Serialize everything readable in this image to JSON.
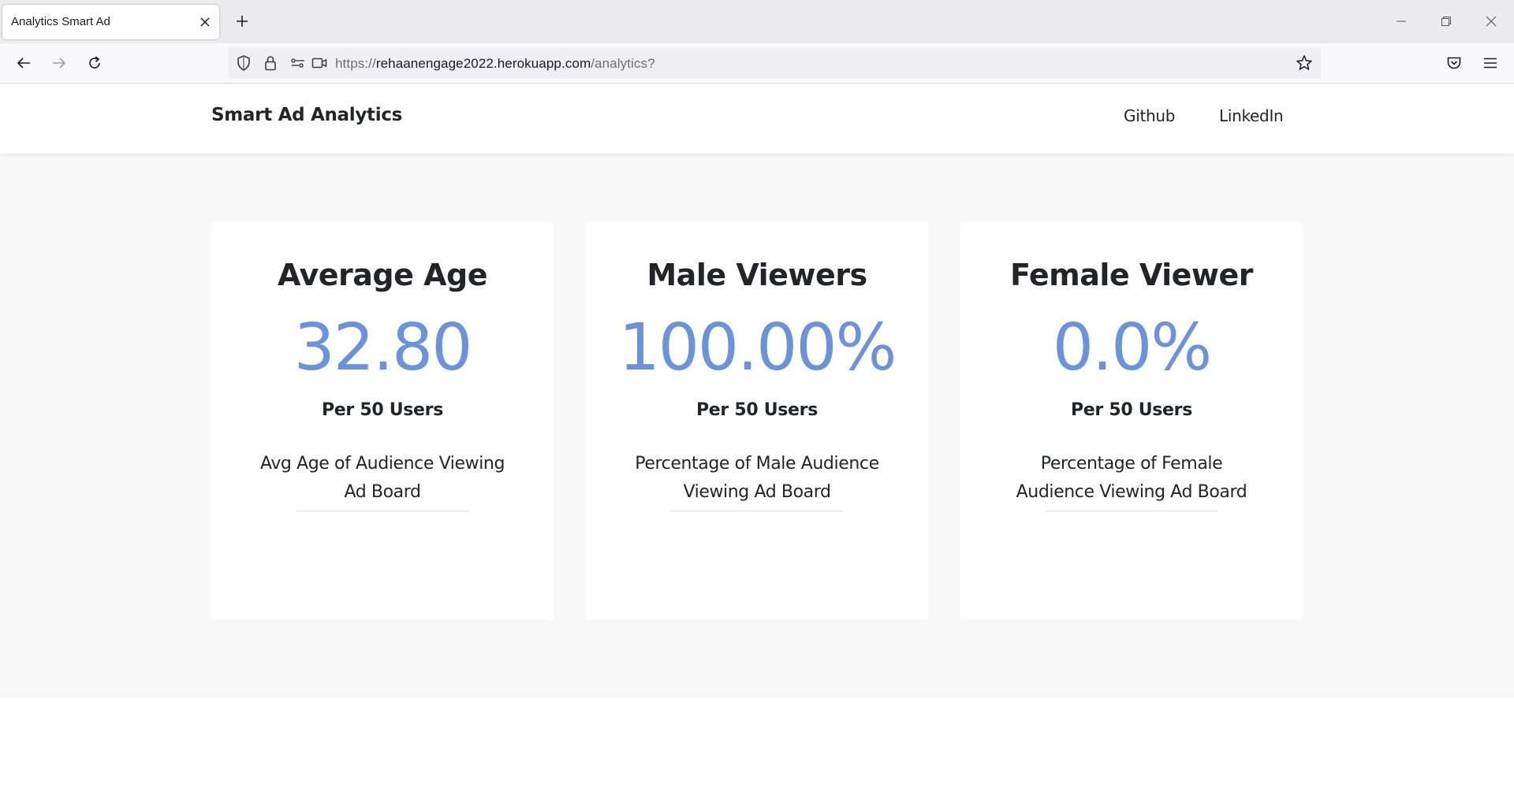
{
  "browser": {
    "tab_title": "Analytics Smart Ad",
    "url_prefix": "https://",
    "url_host": "rehaanengage2022.herokuapp.com",
    "url_path": "/analytics?"
  },
  "site": {
    "brand": "Smart Ad Analytics",
    "nav": [
      {
        "label": "Github"
      },
      {
        "label": "LinkedIn"
      }
    ]
  },
  "cards": [
    {
      "title": "Average Age",
      "value": "32.80",
      "subtitle": "Per 50 Users",
      "description": "Avg Age of Audience Viewing Ad Board"
    },
    {
      "title": "Male Viewers",
      "value": "100.00%",
      "subtitle": "Per 50 Users",
      "description": "Percentage of Male Audience Viewing Ad Board"
    },
    {
      "title": "Female Viewer",
      "value": "0.0%",
      "subtitle": "Per 50 Users",
      "description": "Percentage of Female Audience Viewing Ad Board"
    }
  ],
  "colors": {
    "accent": "#6a93dc",
    "text": "#212529",
    "band": "#f9f9f9"
  }
}
